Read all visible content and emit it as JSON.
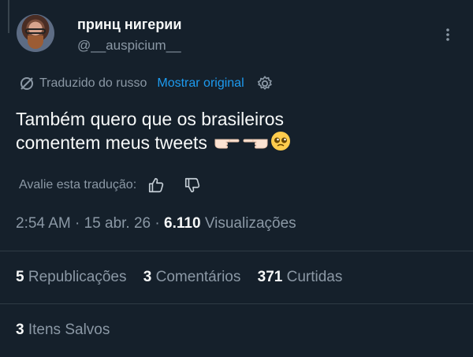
{
  "author": {
    "display_name": "принц нигерии",
    "handle": "@__auspicium__"
  },
  "translation": {
    "label": "Traduzido do russo",
    "show_original": "Mostrar original"
  },
  "tweet": {
    "line1": "Também quero que os brasileiros",
    "line2": "comentem meus tweets",
    "emojis": [
      "pointing-right-hand-emoji",
      "pointing-left-hand-emoji",
      "pleading-face-emoji"
    ]
  },
  "rate": {
    "label": "Avalie esta tradução:"
  },
  "meta": {
    "time": "2:54 AM",
    "sep1": "·",
    "date": "15 abr. 26",
    "sep2": "·",
    "views_count": "6.110",
    "views_label": "Visualizações"
  },
  "stats": {
    "reposts_count": "5",
    "reposts_label": "Republicações",
    "comments_count": "3",
    "comments_label": "Comentários",
    "likes_count": "371",
    "likes_label": "Curtidas",
    "saved_count": "3",
    "saved_label": "Itens Salvos"
  },
  "colors": {
    "background": "#15202b",
    "accent": "#1d9bf0",
    "secondary_text": "#8b98a5"
  }
}
